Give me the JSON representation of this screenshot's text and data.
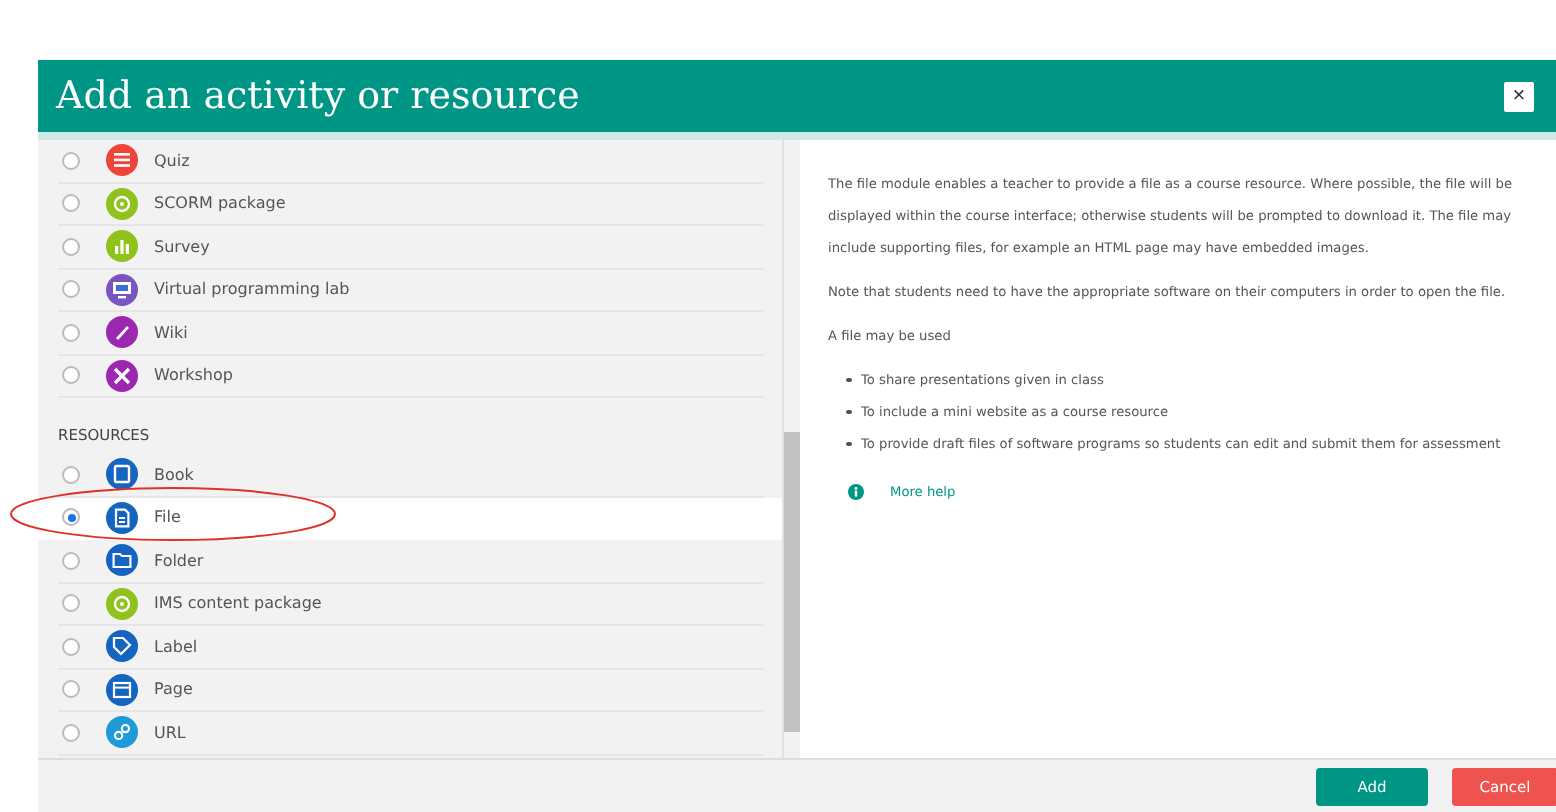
{
  "dialog": {
    "title": "Add an activity or resource",
    "close_label": "×"
  },
  "sections": [
    {
      "items": [
        {
          "label": "Quiz",
          "kind": "list",
          "color": "#f0433a",
          "selected": false
        },
        {
          "label": "SCORM package",
          "kind": "gear",
          "color": "#8fc21b",
          "selected": false
        },
        {
          "label": "Survey",
          "kind": "chart",
          "color": "#8fc21b",
          "selected": false
        },
        {
          "label": "Virtual programming lab",
          "kind": "screen",
          "color": "#7a55c0",
          "selected": false
        },
        {
          "label": "Wiki",
          "kind": "pen",
          "color": "#9c27b0",
          "selected": false
        },
        {
          "label": "Workshop",
          "kind": "tools",
          "color": "#9c27b0",
          "selected": false
        }
      ]
    },
    {
      "heading": "RESOURCES",
      "items": [
        {
          "label": "Book",
          "kind": "book",
          "color": "#1565c0",
          "selected": false
        },
        {
          "label": "File",
          "kind": "file",
          "color": "#1565c0",
          "selected": true
        },
        {
          "label": "Folder",
          "kind": "folder",
          "color": "#1565c0",
          "selected": false
        },
        {
          "label": "IMS content package",
          "kind": "gear",
          "color": "#8fc21b",
          "selected": false
        },
        {
          "label": "Label",
          "kind": "tag",
          "color": "#1565c0",
          "selected": false
        },
        {
          "label": "Page",
          "kind": "page",
          "color": "#1565c0",
          "selected": false
        },
        {
          "label": "URL",
          "kind": "link",
          "color": "#1e9ad6",
          "selected": false
        }
      ]
    }
  ],
  "description": {
    "paragraphs": [
      "The file module enables a teacher to provide a file as a course resource. Where possible, the file will be displayed within the course interface; otherwise students will be prompted to download it. The file may include supporting files, for example an HTML page may have embedded images.",
      "Note that students need to have the appropriate software on their computers in order to open the file.",
      "A file may be used"
    ],
    "bullets": [
      "To share presentations given in class",
      "To include a mini website as a course resource",
      "To provide draft files of software programs so students can edit and submit them for assessment"
    ],
    "help_link": "More help"
  },
  "buttons": [
    {
      "label": "Add",
      "kind": "primary"
    },
    {
      "label": "Cancel",
      "kind": "danger"
    }
  ]
}
